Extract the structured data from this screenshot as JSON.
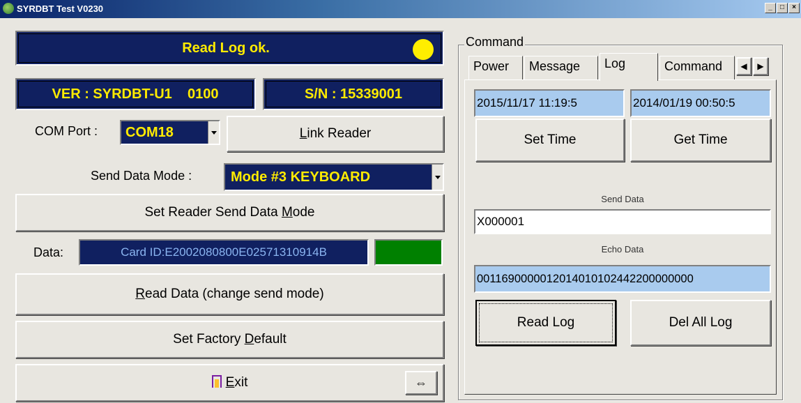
{
  "window": {
    "title": "SYRDBT Test V0230"
  },
  "status": {
    "text": "Read Log ok.",
    "indicator_color": "#ffee00"
  },
  "version": {
    "ver": "VER : SYRDBT-U1    0100",
    "sn": "S/N : 15339001"
  },
  "com": {
    "label": "COM Port :",
    "value": "COM18"
  },
  "link_button": {
    "prefix": "L",
    "rest": "ink Reader"
  },
  "send_mode": {
    "label": "Send Data Mode :",
    "value": "Mode #3 KEYBOARD"
  },
  "set_mode_button": {
    "before": "Set Reader Send Data ",
    "u": "M",
    "after": "ode"
  },
  "data": {
    "label": "Data:",
    "value": "Card ID:E2002080800E02571310914B",
    "status_color": "#008000"
  },
  "read_data_button": {
    "u": "R",
    "after": "ead Data (change send mode)"
  },
  "factory_button": {
    "before": "Set Factory ",
    "u": "D",
    "after": "efault"
  },
  "exit_button": {
    "u": "E",
    "after": "xit"
  },
  "resize_glyph": "⇔",
  "command": {
    "group_label": "Command",
    "tabs": [
      "Power",
      "Message",
      "Log",
      "Command"
    ],
    "active_tab": "Log",
    "time1": "2015/11/17 11:19:5",
    "time2": "2014/01/19 00:50:5",
    "set_time": "Set Time",
    "get_time": "Get Time",
    "send_label": "Send Data",
    "send_value": "X000001",
    "echo_label": "Echo Data",
    "echo_value": "0011690000012014010102442200000000",
    "read_log": "Read Log",
    "del_log": "Del All Log"
  }
}
